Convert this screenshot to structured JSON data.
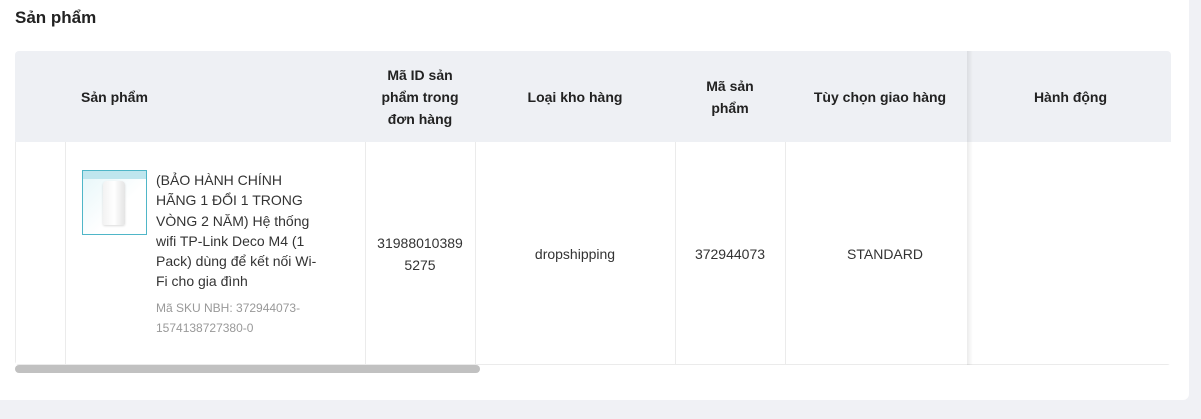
{
  "section": {
    "title": "Sản phẩm"
  },
  "table": {
    "headers": {
      "product": "Sản phẩm",
      "order_product_id": "Mã ID sản phẩm trong đơn hàng",
      "warehouse_type": "Loại kho hàng",
      "product_code": "Mã sản phẩm",
      "shipping_option": "Tùy chọn giao hàng",
      "action": "Hành động"
    },
    "rows": [
      {
        "product_name": "(BẢO HÀNH CHÍNH HÃNG 1 ĐỔI 1 TRONG VÒNG 2 NĂM) Hệ thống wifi TP-Link Deco M4 (1 Pack) dùng để kết nối Wi-Fi cho gia đình",
        "sku": "Mã SKU NBH: 372944073-1574138727380-0",
        "order_product_id": "319880103895275",
        "warehouse_type": "dropshipping",
        "product_code": "372944073",
        "shipping_option": "STANDARD",
        "action": ""
      }
    ]
  },
  "scroll": {
    "horizontal_position": 0.0
  }
}
